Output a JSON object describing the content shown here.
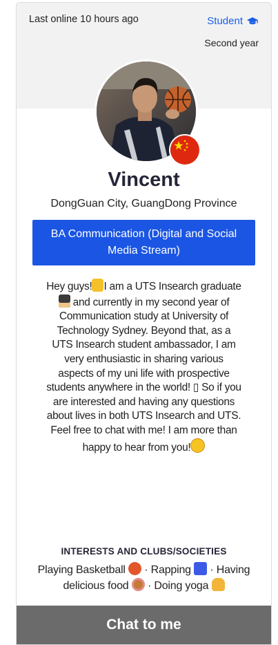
{
  "profile": {
    "last_online": "Last online 10 hours ago",
    "badge": "Student",
    "badge_icon": "graduation-cap-icon",
    "year": "Second year",
    "name": "Vincent",
    "location": "DongGuan City, GuangDong Province",
    "course": "BA Communication (Digital and Social Media Stream)",
    "flag": "china-flag-icon",
    "bio_parts": [
      "Hey guys!",
      "I am a UTS Insearch graduate",
      "and currently in my second year of Communication study at University of Technology Sydney. Beyond that, as a UTS Insearch student ambassador, I am very enthusiastic in sharing various aspects of my uni life with prospective students anywhere in the world! ▯ So if you are interested and having any questions about lives in both UTS Insearch and UTS. Feel free to chat with me! I am more than happy to hear from you!"
    ],
    "interests_title": "INTERESTS AND CLUBS/SOCIETIES",
    "interests": [
      "Playing Basketball",
      "Rapping",
      "Having delicious food",
      "Doing yoga"
    ],
    "interest_separator": " · ",
    "chat_label": "Chat to me"
  },
  "colors": {
    "accent": "#1a55e3",
    "badge_text": "#1a5fe6",
    "chat_button": "#6b6b6b",
    "top_band": "#f2f2f2"
  }
}
